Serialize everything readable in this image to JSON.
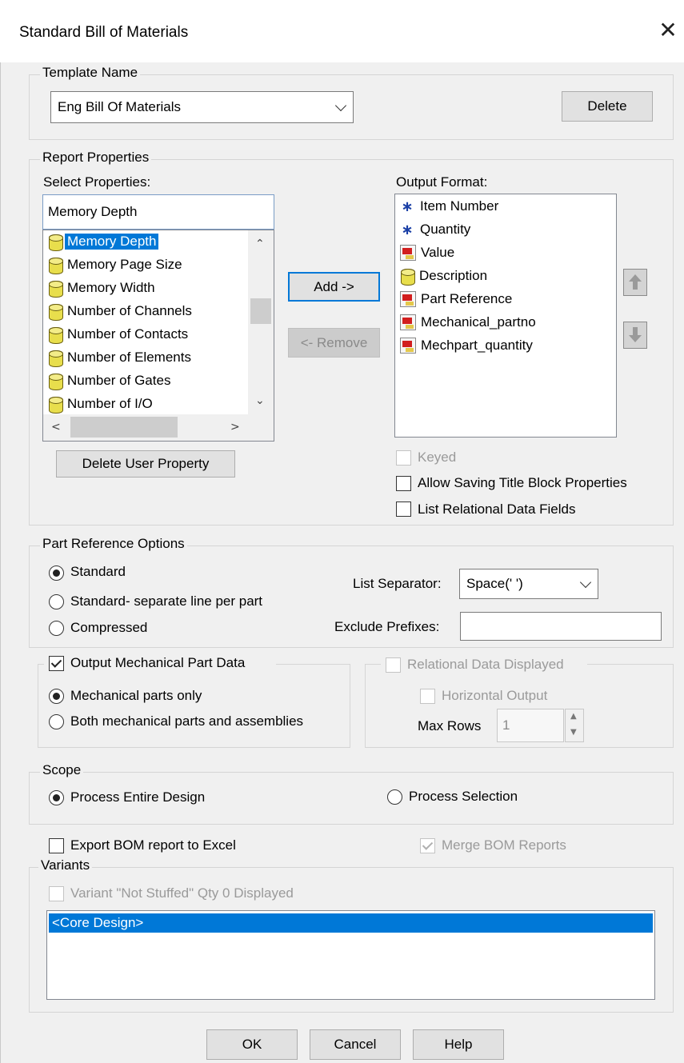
{
  "window": {
    "title": "Standard Bill of Materials",
    "close_glyph": "✕"
  },
  "template": {
    "legend": "Template Name",
    "selected": "Eng Bill Of Materials",
    "delete_label": "Delete"
  },
  "report": {
    "legend": "Report Properties",
    "select_label": "Select Properties:",
    "select_input_value": "Memory Depth",
    "properties": [
      {
        "label": "Memory Depth",
        "icon": "database-icon",
        "selected": true
      },
      {
        "label": "Memory Page Size",
        "icon": "database-icon"
      },
      {
        "label": "Memory Width",
        "icon": "database-icon"
      },
      {
        "label": "Number of Channels",
        "icon": "database-icon"
      },
      {
        "label": "Number of Contacts",
        "icon": "database-icon"
      },
      {
        "label": "Number of Elements",
        "icon": "database-icon"
      },
      {
        "label": "Number of Gates",
        "icon": "database-icon"
      },
      {
        "label": "Number of I/O",
        "icon": "database-icon"
      }
    ],
    "add_label": "Add ->",
    "remove_label": "<- Remove",
    "output_label": "Output Format:",
    "output_items": [
      {
        "label": "Item Number",
        "icon": "asterisk-icon"
      },
      {
        "label": "Quantity",
        "icon": "asterisk-icon"
      },
      {
        "label": "Value",
        "icon": "part-property-icon"
      },
      {
        "label": "Description",
        "icon": "database-icon"
      },
      {
        "label": "Part Reference",
        "icon": "part-property-icon"
      },
      {
        "label": "Mechanical_partno",
        "icon": "part-property-icon"
      },
      {
        "label": "Mechpart_quantity",
        "icon": "part-property-icon"
      }
    ],
    "delete_user_property_label": "Delete User Property",
    "keyed_label": "Keyed",
    "allow_saving_label": "Allow Saving Title Block Properties",
    "list_relational_label": "List Relational Data Fields"
  },
  "part_ref": {
    "legend": "Part Reference Options",
    "standard_label": "Standard",
    "separate_label": "Standard- separate line per part",
    "compressed_label": "Compressed",
    "list_separator_label": "List Separator:",
    "list_separator_value": "Space(' ')",
    "exclude_prefixes_label": "Exclude Prefixes:",
    "exclude_prefixes_value": ""
  },
  "mechanical": {
    "output_label": "Output Mechanical Part Data",
    "output_checked": true,
    "parts_only_label": "Mechanical parts only",
    "both_label": "Both mechanical parts and assemblies"
  },
  "relational": {
    "displayed_label": "Relational Data Displayed",
    "horizontal_label": "Horizontal Output",
    "max_rows_label": "Max Rows",
    "max_rows_value": "1"
  },
  "scope": {
    "legend": "Scope",
    "entire_label": "Process Entire Design",
    "selection_label": "Process Selection"
  },
  "export": {
    "excel_label": "Export BOM report to Excel",
    "merge_label": "Merge BOM Reports"
  },
  "variants": {
    "legend": "Variants",
    "not_stuffed_label": "Variant \"Not Stuffed\" Qty 0 Displayed",
    "items": [
      "<Core Design>"
    ]
  },
  "footer": {
    "ok_label": "OK",
    "cancel_label": "Cancel",
    "help_label": "Help"
  },
  "colors": {
    "selection": "#0078d7",
    "accent_border": "#0078d7"
  }
}
